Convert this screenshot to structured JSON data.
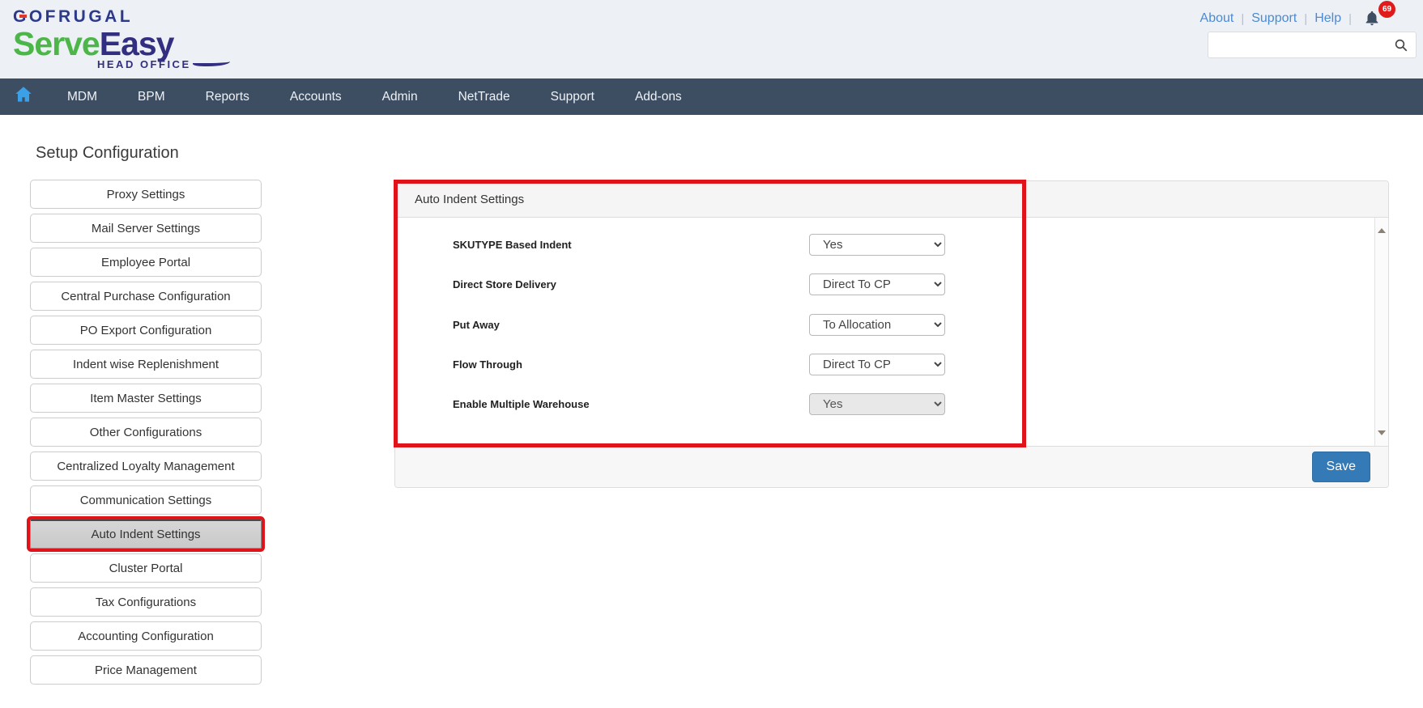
{
  "brand": {
    "company": "GOFRUGAL",
    "product_serve": "Serve",
    "product_easy": "Easy",
    "office": "HEAD OFFICE"
  },
  "header": {
    "links": [
      {
        "label": "About"
      },
      {
        "label": "Support"
      },
      {
        "label": "Help"
      }
    ],
    "notification_count": "69",
    "search": {
      "value": "",
      "placeholder": ""
    }
  },
  "nav": {
    "items": [
      "MDM",
      "BPM",
      "Reports",
      "Accounts",
      "Admin",
      "NetTrade",
      "Support",
      "Add-ons"
    ]
  },
  "sidebar": {
    "title": "Setup Configuration",
    "selected_item": "Auto Indent Settings",
    "items": [
      "Proxy Settings",
      "Mail Server Settings",
      "Employee Portal",
      "Central Purchase Configuration",
      "PO Export Configuration",
      "Indent wise Replenishment",
      "Item Master Settings",
      "Other Configurations",
      "Centralized Loyalty Management",
      "Communication Settings",
      "Auto Indent Settings",
      "Cluster Portal",
      "Tax Configurations",
      "Accounting Configuration",
      "Price Management"
    ]
  },
  "panel": {
    "title": "Auto Indent Settings",
    "fields": [
      {
        "label": "SKUTYPE Based Indent",
        "value": "Yes",
        "disabled": false
      },
      {
        "label": "Direct Store Delivery",
        "value": "Direct To CP",
        "disabled": false
      },
      {
        "label": "Put Away",
        "value": "To Allocation",
        "disabled": false
      },
      {
        "label": "Flow Through",
        "value": "Direct To CP",
        "disabled": false
      },
      {
        "label": "Enable Multiple Warehouse",
        "value": "Yes",
        "disabled": true
      }
    ],
    "save_label": "Save"
  },
  "icons": [
    "home-icon",
    "bell-icon",
    "search-icon",
    "scroll-up-icon",
    "scroll-down-icon"
  ],
  "colors": {
    "annotation_red": "#e0121a",
    "nav_bg": "#3d4d62",
    "home_icon_blue": "#3aa0e8",
    "link_blue": "#4b8bd2",
    "badge_red": "#e01b1b",
    "save_blue": "#337ab7",
    "brand_green": "#4cb748",
    "brand_navy": "#322e80",
    "header_bg": "#edf0f5"
  }
}
